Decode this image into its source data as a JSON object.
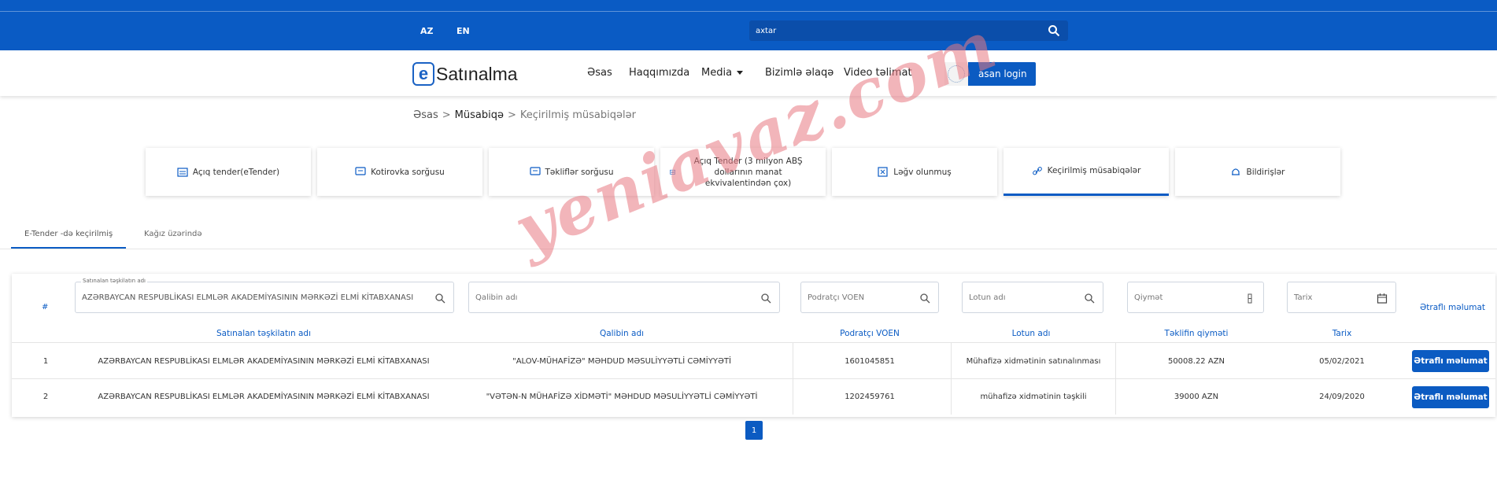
{
  "topbar": {
    "languages": [
      "AZ",
      "EN"
    ],
    "search_placeholder": "axtar"
  },
  "navbar": {
    "logo_letter": "e",
    "logo_text": "Satınalma",
    "links": [
      "Əsas",
      "Haqqımızda",
      "Media",
      "Bizimlə əlaqə",
      "Video təlimat"
    ],
    "login_label": "asan login"
  },
  "breadcrumb": {
    "items": [
      "Əsas",
      "Müsabiqə",
      "Keçirilmiş müsabiqələr"
    ],
    "separator": ">"
  },
  "cards": [
    {
      "label": "Açıq tender(eTender)",
      "icon": "tender-icon"
    },
    {
      "label": "Kotirovka sorğusu",
      "icon": "chat-icon"
    },
    {
      "label": "Təkliflər sorğusu",
      "icon": "chat-icon"
    },
    {
      "label": "Açıq Tender (3 milyon ABŞ dollarının manat ekvivalentindən çox)",
      "icon": "tender-icon"
    },
    {
      "label": "Ləğv olunmuş",
      "icon": "close-box-icon"
    },
    {
      "label": "Keçirilmiş müsabiqələr",
      "icon": "link-icon",
      "active": true
    },
    {
      "label": "Bildirişlər",
      "icon": "bell-icon"
    }
  ],
  "tabs": [
    "E-Tender -də keçirilmiş",
    "Kağız üzərində"
  ],
  "filters": {
    "hash_label": "#",
    "org_label": "Satınalan təşkilatın adı",
    "org_value": "AZƏRBAYCAN RESPUBLİKASI ELMLƏR AKADEMİYASININ MƏRKƏZİ ELMİ KİTABXANASI",
    "winner_placeholder": "Qalibin adı",
    "voen_placeholder": "Podratçı VOEN",
    "lot_placeholder": "Lotun adı",
    "price_placeholder": "Qiymət",
    "date_placeholder": "Tarix",
    "more_label": "Ətraflı məlumat"
  },
  "table": {
    "headers": [
      "Satınalan təşkilatın adı",
      "Qalibin adı",
      "Podratçı VOEN",
      "Lotun adı",
      "Təklifin qiyməti",
      "Tarix"
    ],
    "rows": [
      {
        "index": "1",
        "org": "AZƏRBAYCAN RESPUBLİKASI ELMLƏR AKADEMİYASININ MƏRKƏZİ ELMİ KİTABXANASI",
        "winner": "\"ALOV-MÜHAFİZƏ\" MƏHDUD MƏSULİYYƏTLİ CƏMİYYƏTİ",
        "voen": "1601045851",
        "lot": "Mühafizə xidmətinin satınalınması",
        "price": "50008.22 AZN",
        "date": "05/02/2021",
        "button": "Ətraflı məlumat"
      },
      {
        "index": "2",
        "org": "AZƏRBAYCAN RESPUBLİKASI ELMLƏR AKADEMİYASININ MƏRKƏZİ ELMİ KİTABXANASI",
        "winner": "\"VƏTƏN-N MÜHAFİZƏ XİDMƏTİ\" MƏHDUD MƏSULİYYƏTLİ CƏMİYYƏTİ",
        "voen": "1202459761",
        "lot": "mühafizə xidmətinin təşkili",
        "price": "39000 AZN",
        "date": "24/09/2020",
        "button": "Ətraflı məlumat"
      }
    ]
  },
  "pagination": {
    "current": "1"
  },
  "watermark": "yeniavaz.com"
}
